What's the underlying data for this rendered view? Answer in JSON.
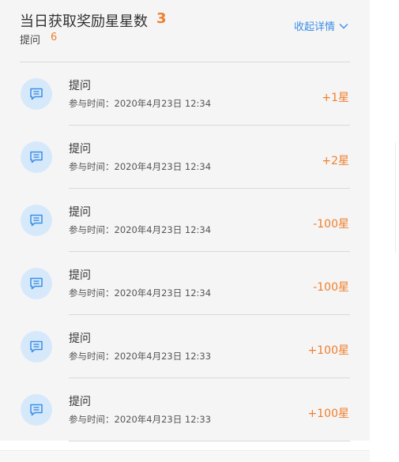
{
  "header": {
    "title": "当日获取奖励星星数",
    "star_count": "3",
    "sub_label": "提问",
    "sub_count": "6",
    "collapse_label": "收起详情"
  },
  "records": [
    {
      "title": "提问",
      "time": "参与时间：2020年4月23日  12:34",
      "value": "+1星"
    },
    {
      "title": "提问",
      "time": "参与时间：2020年4月23日  12:34",
      "value": "+2星"
    },
    {
      "title": "提问",
      "time": "参与时间：2020年4月23日  12:34",
      "value": "-100星"
    },
    {
      "title": "提问",
      "time": "参与时间：2020年4月23日  12:34",
      "value": "-100星"
    },
    {
      "title": "提问",
      "time": "参与时间：2020年4月23日  12:33",
      "value": "+100星"
    },
    {
      "title": "提问",
      "time": "参与时间：2020年4月23日  12:33",
      "value": "+100星"
    }
  ],
  "colors": {
    "accent_orange": "#f07e2c",
    "link_blue": "#3b8ee6",
    "icon_bg": "#d6e9fb"
  },
  "icons": {
    "row_icon": "message-icon",
    "collapse_icon": "chevron-down-icon"
  }
}
